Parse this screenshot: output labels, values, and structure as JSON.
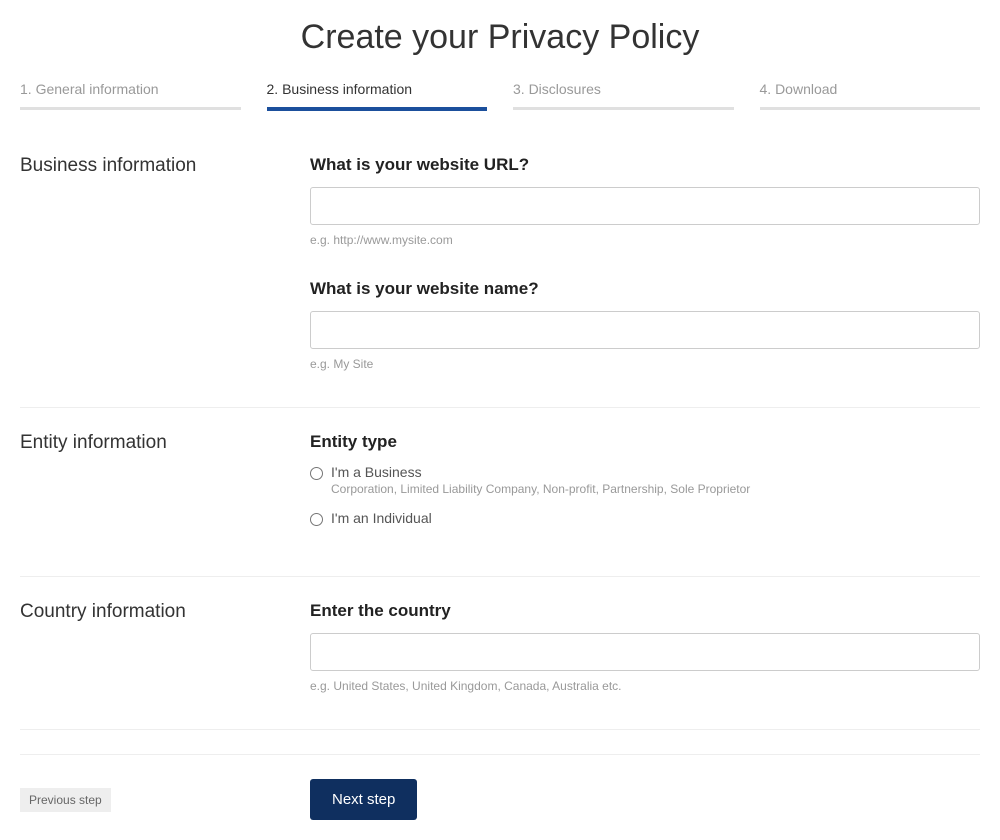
{
  "title": "Create your Privacy Policy",
  "steps": [
    {
      "label": "1. General information"
    },
    {
      "label": "2. Business information"
    },
    {
      "label": "3. Disclosures"
    },
    {
      "label": "4. Download"
    }
  ],
  "sections": {
    "business": {
      "heading": "Business information",
      "url_label": "What is your website URL?",
      "url_value": "",
      "url_hint": "e.g. http://www.mysite.com",
      "name_label": "What is your website name?",
      "name_value": "",
      "name_hint": "e.g. My Site"
    },
    "entity": {
      "heading": "Entity information",
      "type_label": "Entity type",
      "option_business_label": "I'm a Business",
      "option_business_sub": "Corporation, Limited Liability Company, Non-profit, Partnership, Sole Proprietor",
      "option_individual_label": "I'm an Individual"
    },
    "country": {
      "heading": "Country information",
      "country_label": "Enter the country",
      "country_value": "",
      "country_hint": "e.g. United States, United Kingdom, Canada, Australia etc."
    }
  },
  "footer": {
    "previous_label": "Previous step",
    "next_label": "Next step"
  }
}
